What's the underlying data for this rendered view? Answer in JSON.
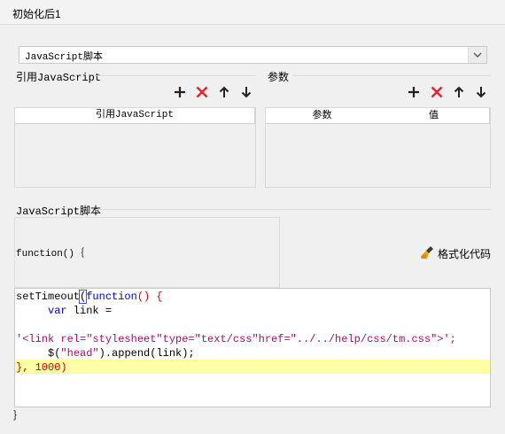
{
  "window": {
    "title": "初始化后1"
  },
  "script_type_select": {
    "value": "JavaScript脚本"
  },
  "ref_panel": {
    "label": "引用JavaScript",
    "columns": [
      "引用JavaScript"
    ]
  },
  "param_panel": {
    "label": "参数",
    "columns": [
      "参数",
      "值"
    ]
  },
  "script_section": {
    "label": "JavaScript脚本",
    "function_header": "function()｛",
    "format_button": "格式化代码",
    "code": {
      "l1_a": "setTimeout",
      "l1_b": "(",
      "l1_c": "function",
      "l1_d": "() {",
      "l2_a": "     var",
      "l2_b": " link =",
      "l3": "",
      "l4": "'<link rel=\"stylesheet\"type=\"text/css\"href=\"../../help/css/tm.css\">';",
      "l5_a": "     $(",
      "l5_b": "\"head\"",
      "l5_c": ").append(link);",
      "l6": "}, 1000)"
    },
    "closing_brace": "｝"
  },
  "icons": {
    "add": "plus-icon",
    "delete": "x-icon",
    "up": "arrow-up-icon",
    "down": "arrow-down-icon",
    "format": "broom-icon"
  },
  "colors": {
    "delete": "#e0262b",
    "keyword": "#0000cc",
    "string": "#a0106e",
    "highlight": "#ffffa6"
  }
}
